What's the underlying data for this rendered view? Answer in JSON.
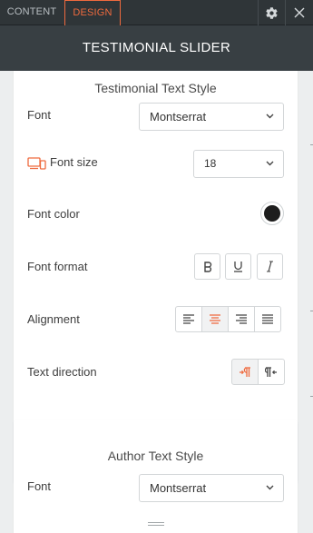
{
  "tabs": {
    "content": "CONTENT",
    "design": "DESIGN"
  },
  "header": {
    "title": "TESTIMONIAL SLIDER"
  },
  "testimonial_section": {
    "title": "Testimonial Text Style",
    "font_label": "Font",
    "font_value": "Montserrat",
    "font_size_label": "Font size",
    "font_size_value": "18",
    "font_color_label": "Font color",
    "font_color": "#1d1d1d",
    "font_format_label": "Font format",
    "format_buttons": [
      "bold-icon",
      "underline-icon",
      "italic-icon"
    ],
    "alignment_label": "Alignment",
    "alignment_buttons": [
      "align-left-icon",
      "align-center-icon",
      "align-right-icon",
      "align-justify-icon"
    ],
    "alignment_selected": "center",
    "text_direction_label": "Text direction",
    "text_direction_selected": "ltr"
  },
  "author_section": {
    "title": "Author Text Style",
    "font_label": "Font",
    "font_value": "Montserrat"
  },
  "colors": {
    "accent": "#ef6a3e",
    "tabbar": "#2f3538",
    "titlebar": "#383f43"
  }
}
